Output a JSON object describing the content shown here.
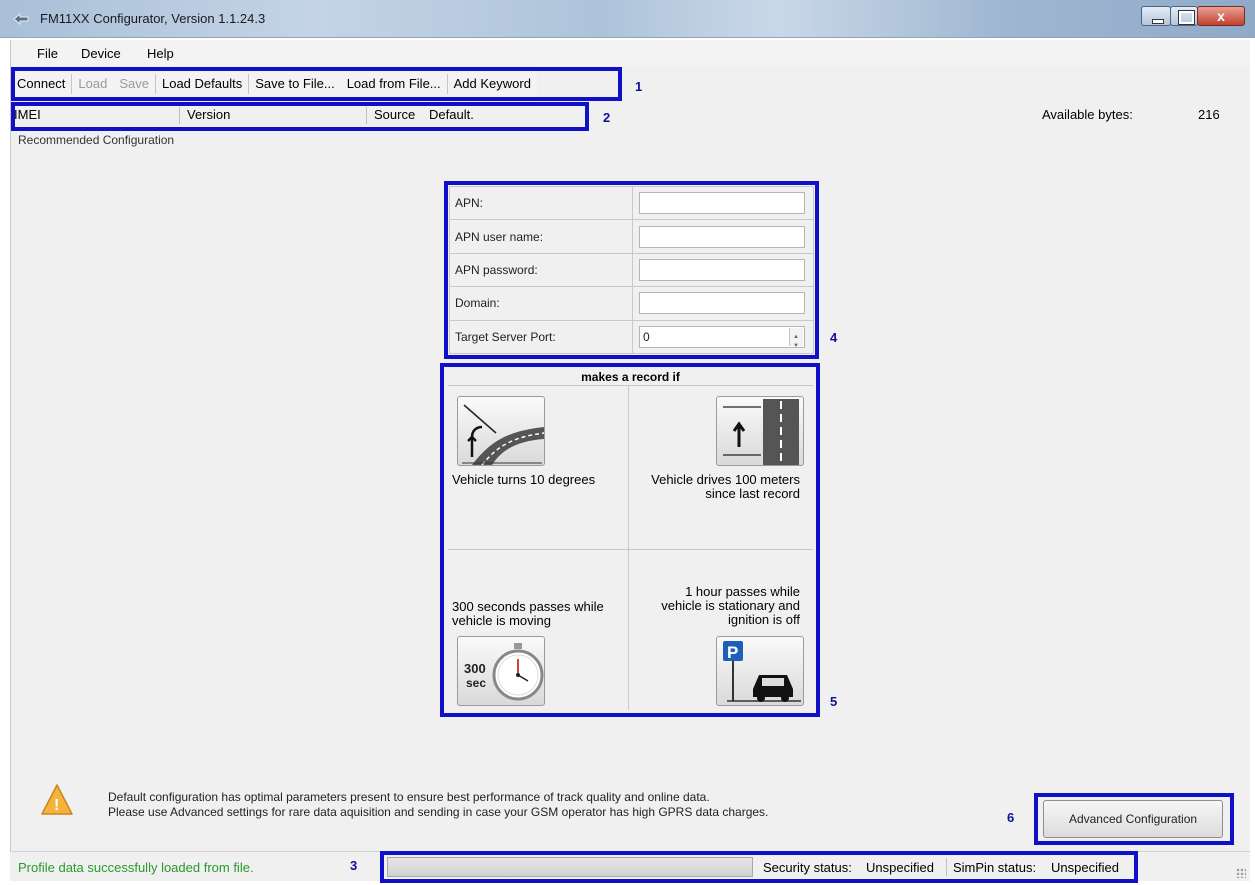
{
  "window": {
    "title": "FM11XX Configurator, Version 1.1.24.3",
    "close_glyph": "x"
  },
  "menu": [
    "File",
    "Device",
    "Help"
  ],
  "toolbar": {
    "items": [
      {
        "label": "Connect",
        "enabled": true
      },
      {
        "label": "Load",
        "enabled": false
      },
      {
        "label": "Save",
        "enabled": false
      },
      {
        "label": "Load Defaults",
        "enabled": true
      },
      {
        "label": "Save to File...",
        "enabled": true
      },
      {
        "label": "Load from File...",
        "enabled": true
      },
      {
        "label": "Add Keyword",
        "enabled": true
      }
    ]
  },
  "info": {
    "imei_label": "IMEI",
    "version_label": "Version",
    "source_label": "Source",
    "source_value": "Default.",
    "available_label": "Available bytes:",
    "available_value": "216"
  },
  "recommended_label": "Recommended Configuration",
  "apn": {
    "fields": [
      {
        "label": "APN:",
        "value": ""
      },
      {
        "label": "APN user name:",
        "value": ""
      },
      {
        "label": "APN password:",
        "value": ""
      },
      {
        "label": "Domain:",
        "value": ""
      },
      {
        "label": "Target Server Port:",
        "value": "0"
      }
    ]
  },
  "record": {
    "title": "makes a record if",
    "turn": "Vehicle turns 10 degrees",
    "distance_l1": "Vehicle drives 100 meters",
    "distance_l2": "since last record",
    "time_l1": "300 seconds passes while",
    "time_l2": "vehicle is moving",
    "stop_l1": "1 hour passes while",
    "stop_l2": "vehicle is stationary and",
    "stop_l3": "ignition is off",
    "timer_l1": "300",
    "timer_l2": "sec",
    "parking_letter": "P"
  },
  "notice": {
    "line1": "Default configuration has optimal parameters present to ensure best performance of track quality and online data.",
    "line2": "Please use Advanced settings for rare data aquisition and sending in case your GSM operator has high GPRS data charges.",
    "warning_glyph": "!"
  },
  "advanced_button": "Advanced Configuration",
  "status": {
    "message": "Profile data successfully loaded from file.",
    "progress": 0,
    "security_label": "Security status:",
    "security_value": "Unspecified",
    "simpin_label": "SimPin status:",
    "simpin_value": "Unspecified"
  },
  "callouts": [
    "1",
    "2",
    "3",
    "4",
    "5",
    "6"
  ],
  "colors": {
    "highlight": "#1010c8",
    "status_ok": "#2a9a2a",
    "callout": "#10109a"
  }
}
